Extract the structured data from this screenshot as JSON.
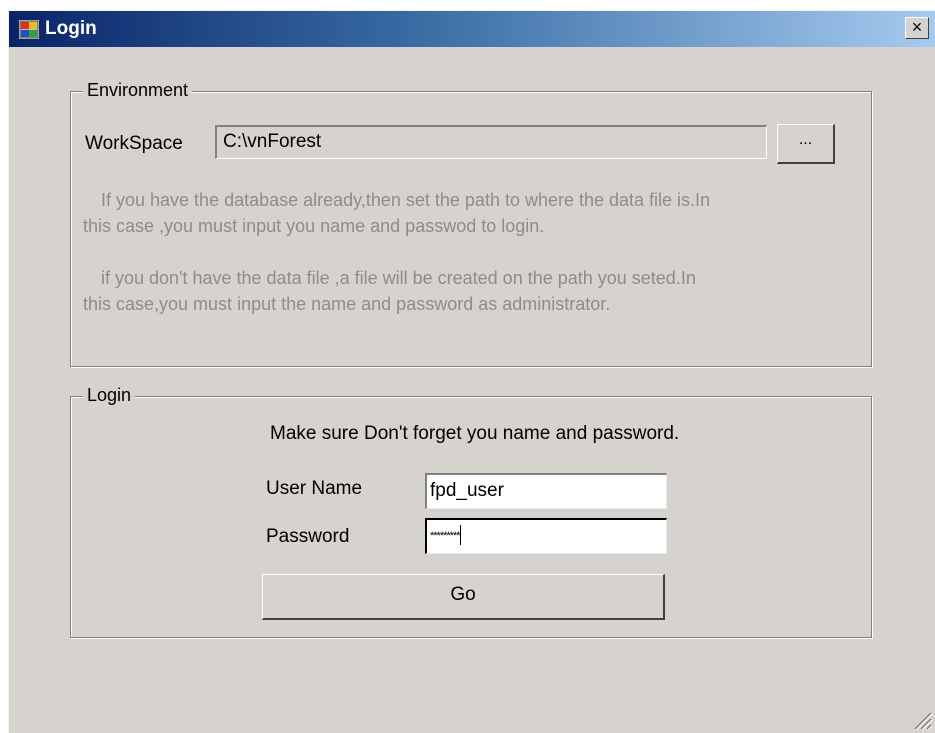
{
  "window": {
    "title": "Login",
    "close_label": "×"
  },
  "environment": {
    "legend": "Environment",
    "workspace_label": "WorkSpace",
    "workspace_value": "C:\\vnForest",
    "browse_label": "...",
    "info_line1": "If you have the database already,then set the path to where the data file is.In",
    "info_line2": "this case ,you must input you name and passwod to login.",
    "info_line3": "if you don't have the data file ,a file will be created on the path you seted.In",
    "info_line4": "this case,you must input the name and password as administrator."
  },
  "login": {
    "legend": "Login",
    "hint": "Make sure Don't forget you name and password.",
    "username_label": "User Name",
    "username_value": "fpd_user",
    "password_label": "Password",
    "password_value": "*********",
    "go_label": "Go"
  },
  "colors": {
    "titlebar_start": "#0a246a",
    "titlebar_end": "#a6caf0",
    "window_bg": "#d6d3ce",
    "disabled_text": "#8f8c87"
  },
  "icons": [
    "app-icon",
    "close-icon",
    "resize-grip-icon"
  ]
}
